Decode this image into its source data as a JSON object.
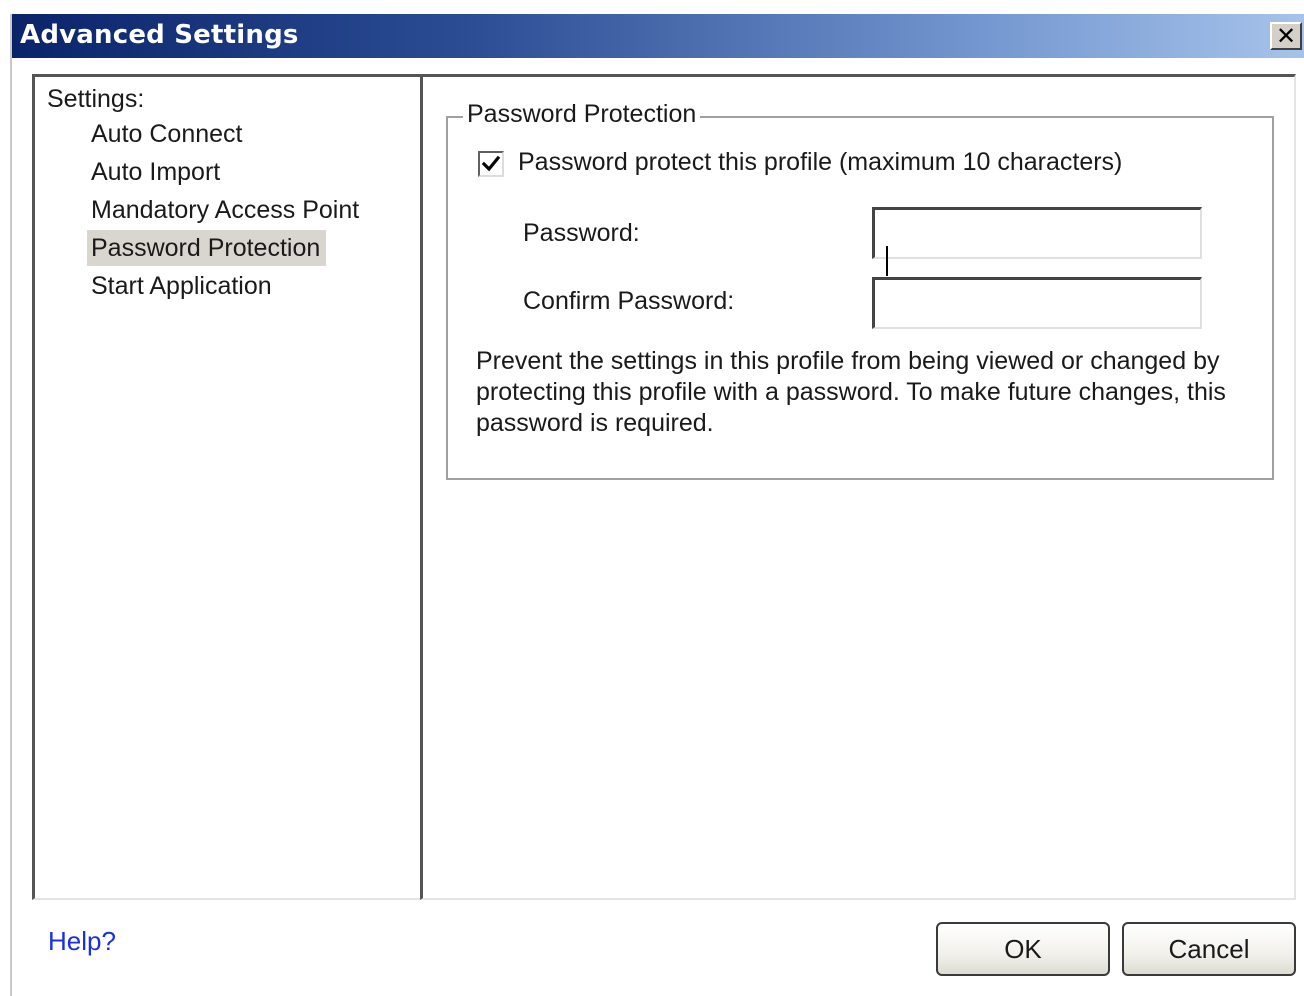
{
  "window": {
    "title": "Advanced Settings",
    "close_icon": "close-icon"
  },
  "settings": {
    "heading": "Settings:",
    "items": [
      {
        "label": "Auto Connect"
      },
      {
        "label": "Auto Import"
      },
      {
        "label": "Mandatory Access Point"
      },
      {
        "label": "Password Protection"
      },
      {
        "label": "Start Application"
      }
    ],
    "selected": "Password Protection"
  },
  "password_group": {
    "legend": "Password Protection",
    "checkbox_label": "Password protect this profile (maximum 10 characters)",
    "checkbox_checked": true,
    "password_label": "Password:",
    "password_value": "",
    "confirm_label": "Confirm Password:",
    "confirm_value": "",
    "description": "Prevent the settings in this profile from being viewed or changed by protecting this profile with a password. To make future changes, this password is required."
  },
  "footer": {
    "help": "Help?",
    "ok": "OK",
    "cancel": "Cancel"
  },
  "colors": {
    "title_gradient_start": "#0a246a",
    "title_gradient_end": "#a6c3ea",
    "selection_bg": "#d9d6d0",
    "link": "#1a2fe0"
  }
}
